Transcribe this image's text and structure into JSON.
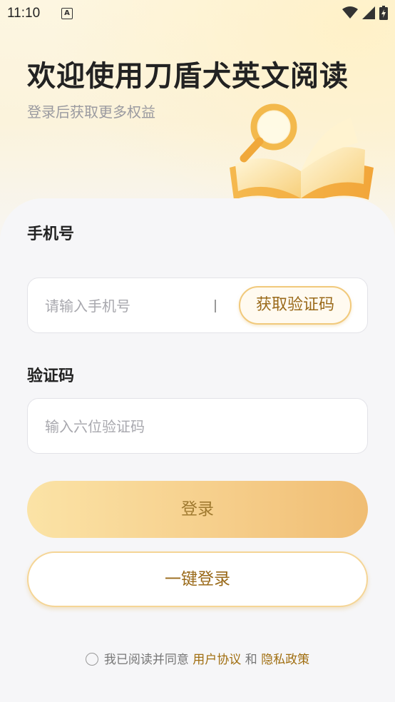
{
  "status_bar": {
    "time": "11:10",
    "notif_glyph": "A"
  },
  "header": {
    "title": "欢迎使用刀盾犬英文阅读",
    "subtitle": "登录后获取更多权益",
    "hero_icon": "book-magnifier-icon"
  },
  "form": {
    "phone_label": "手机号",
    "phone_placeholder": "请输入手机号",
    "get_code_label": "获取验证码",
    "code_label": "验证码",
    "code_placeholder": "输入六位验证码"
  },
  "actions": {
    "login_label": "登录",
    "one_click_label": "一键登录"
  },
  "agreement": {
    "prefix": "我已阅读并同意",
    "user_agreement": "用户协议",
    "and": "和",
    "privacy_policy": "隐私政策"
  },
  "colors": {
    "accent": "#f1c97b",
    "accent_text": "#9a6a1a",
    "background": "#f6f6f8"
  }
}
